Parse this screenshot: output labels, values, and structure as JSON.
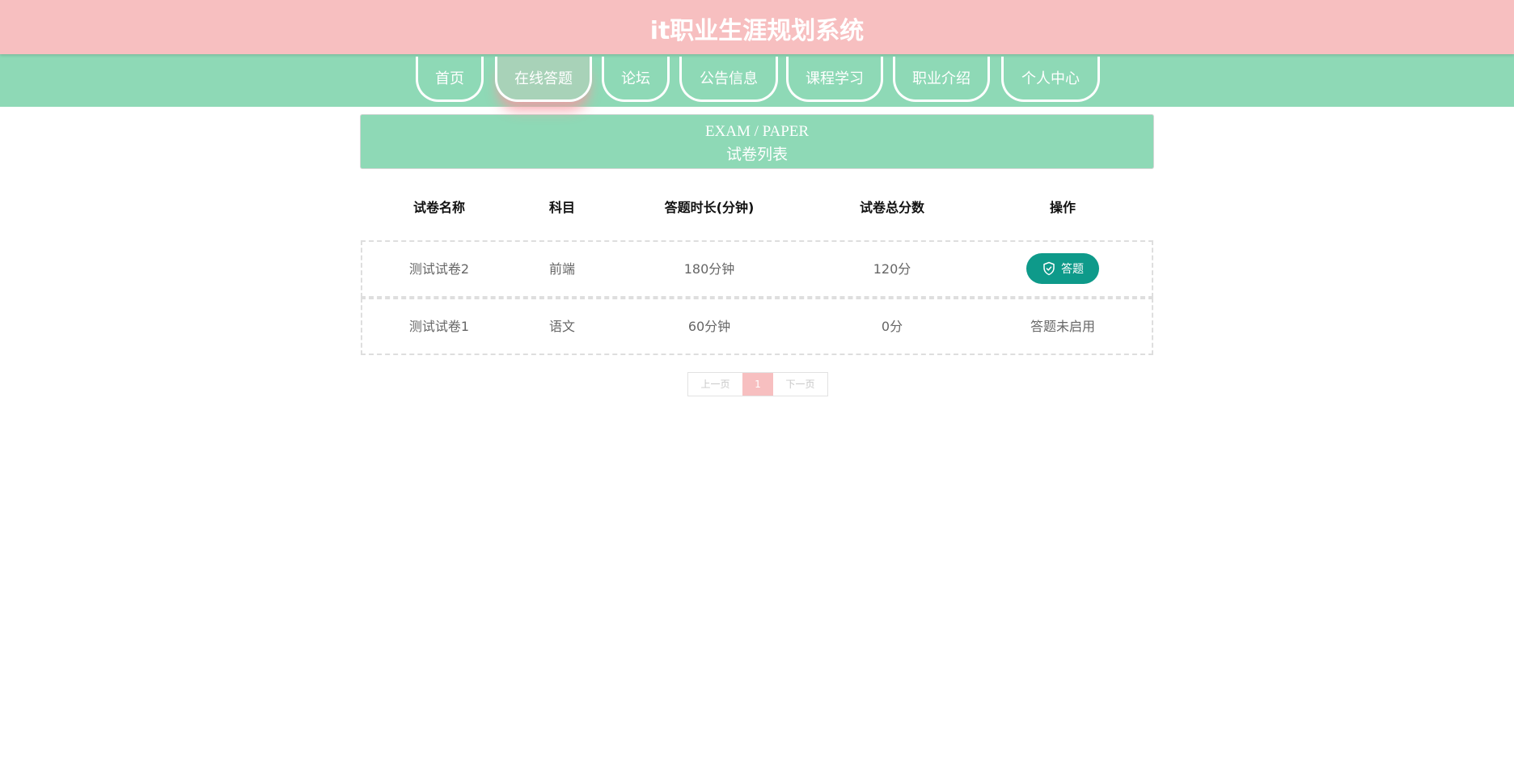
{
  "app": {
    "title": "it职业生涯规划系统"
  },
  "nav": {
    "items": [
      {
        "label": "首页"
      },
      {
        "label": "在线答题"
      },
      {
        "label": "论坛"
      },
      {
        "label": "公告信息"
      },
      {
        "label": "课程学习"
      },
      {
        "label": "职业介绍"
      },
      {
        "label": "个人中心"
      }
    ],
    "active_index": 1
  },
  "section": {
    "en_title": "EXAM / PAPER",
    "cn_title": "试卷列表"
  },
  "table": {
    "headers": [
      "试卷名称",
      "科目",
      "答题时长(分钟)",
      "试卷总分数",
      "操作"
    ],
    "rows": [
      {
        "name": "测试试卷2",
        "subject": "前端",
        "duration": "180分钟",
        "total": "120分",
        "action": "答题",
        "action_type": "button"
      },
      {
        "name": "测试试卷1",
        "subject": "语文",
        "duration": "60分钟",
        "total": "0分",
        "action": "答题未启用",
        "action_type": "text"
      }
    ]
  },
  "pagination": {
    "prev": "上一页",
    "current": "1",
    "next": "下一页"
  },
  "colors": {
    "header_bg": "#f7bfc0",
    "nav_bg": "#8ed9b6",
    "button_bg": "#0e9a8a"
  }
}
